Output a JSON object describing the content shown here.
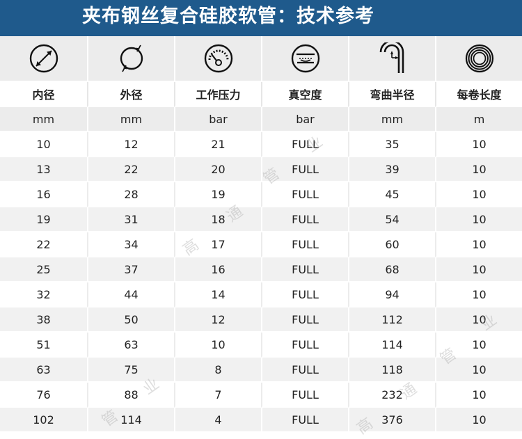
{
  "header": {
    "title": "夹布钢丝复合硅胶软管：技术参考",
    "bg_color": "#1f5a8c"
  },
  "table": {
    "icons": [
      "inner-diameter-icon",
      "outer-diameter-icon",
      "pressure-gauge-icon",
      "vacuum-icon",
      "bend-radius-icon",
      "coil-length-icon"
    ],
    "headers": [
      "内径",
      "外径",
      "工作压力",
      "真空度",
      "弯曲半径",
      "每卷长度"
    ],
    "units": [
      "mm",
      "mm",
      "bar",
      "bar",
      "mm",
      "m"
    ],
    "rows": [
      [
        "10",
        "12",
        "21",
        "FULL",
        "35",
        "10"
      ],
      [
        "13",
        "22",
        "20",
        "FULL",
        "39",
        "10"
      ],
      [
        "16",
        "28",
        "19",
        "FULL",
        "45",
        "10"
      ],
      [
        "19",
        "31",
        "18",
        "FULL",
        "54",
        "10"
      ],
      [
        "22",
        "34",
        "17",
        "FULL",
        "60",
        "10"
      ],
      [
        "25",
        "37",
        "16",
        "FULL",
        "68",
        "10"
      ],
      [
        "32",
        "44",
        "14",
        "FULL",
        "94",
        "10"
      ],
      [
        "38",
        "50",
        "12",
        "FULL",
        "112",
        "10"
      ],
      [
        "51",
        "63",
        "10",
        "FULL",
        "114",
        "10"
      ],
      [
        "63",
        "75",
        "8",
        "FULL",
        "118",
        "10"
      ],
      [
        "76",
        "88",
        "7",
        "FULL",
        "232",
        "10"
      ],
      [
        "102",
        "114",
        "4",
        "FULL",
        "376",
        "10"
      ]
    ]
  },
  "watermark": {
    "chars": [
      "高",
      "通",
      "管",
      "业"
    ]
  }
}
